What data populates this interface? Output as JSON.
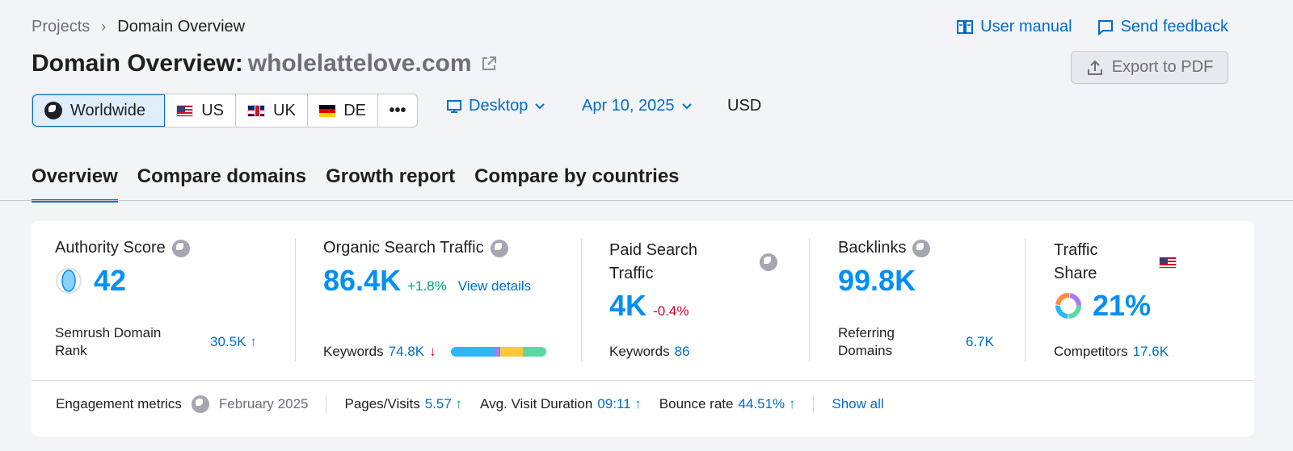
{
  "breadcrumb": {
    "parent": "Projects",
    "current": "Domain Overview"
  },
  "header_links": {
    "user_manual": "User manual",
    "send_feedback": "Send feedback"
  },
  "title": {
    "prefix": "Domain Overview:",
    "domain": "wholelattelove.com"
  },
  "export_label": "Export to PDF",
  "regions": [
    {
      "label": "Worldwide",
      "icon": "globe-icon",
      "active": true
    },
    {
      "label": "US",
      "icon": "flag-us-icon"
    },
    {
      "label": "UK",
      "icon": "flag-uk-icon"
    },
    {
      "label": "DE",
      "icon": "flag-de-icon"
    }
  ],
  "more_label": "•••",
  "device_label": "Desktop",
  "date_label": "Apr 10, 2025",
  "currency_label": "USD",
  "tabs": [
    "Overview",
    "Compare domains",
    "Growth report",
    "Compare by countries"
  ],
  "authority": {
    "label": "Authority Score",
    "value": "42",
    "rank_label": "Semrush Domain Rank",
    "rank_value": "30.5K",
    "rank_trend": "↑"
  },
  "organic": {
    "label": "Organic Search Traffic",
    "value": "86.4K",
    "change": "+1.8%",
    "details_link": "View details",
    "keywords_label": "Keywords",
    "keywords_value": "74.8K",
    "keywords_trend": "↓"
  },
  "paid": {
    "label_line1": "Paid Search",
    "label_line2": "Traffic",
    "value": "4K",
    "change": "-0.4%",
    "keywords_label": "Keywords",
    "keywords_value": "86"
  },
  "backlinks": {
    "label": "Backlinks",
    "value": "99.8K",
    "ref_label_line1": "Referring",
    "ref_label_line2": "Domains",
    "ref_value": "6.7K"
  },
  "traffic_share": {
    "label_line1": "Traffic",
    "label_line2": "Share",
    "value": "21%",
    "competitors_label": "Competitors",
    "competitors_value": "17.6K"
  },
  "engagement": {
    "label": "Engagement metrics",
    "period": "February 2025",
    "pages_label": "Pages/Visits",
    "pages_value": "5.57",
    "pages_trend": "↑",
    "duration_label": "Avg. Visit Duration",
    "duration_value": "09:11",
    "duration_trend": "↑",
    "bounce_label": "Bounce rate",
    "bounce_value": "44.51%",
    "bounce_trend": "↑",
    "show_all": "Show all"
  },
  "colors": {
    "accent": "#006dca",
    "metric": "#008ff8",
    "up": "#009f81",
    "down": "#d1002f"
  }
}
